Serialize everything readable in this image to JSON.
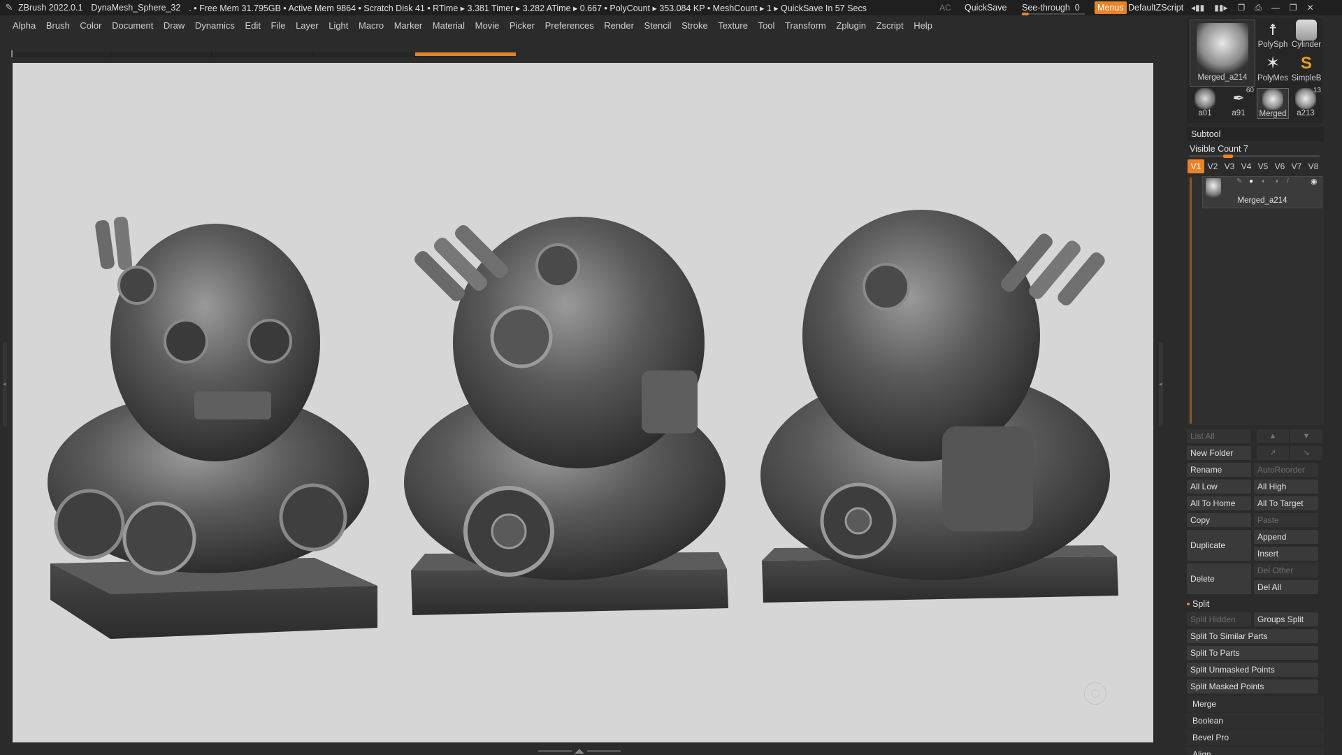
{
  "titlebar": {
    "app_version": "ZBrush 2022.0.1",
    "document": "DynaMesh_Sphere_32",
    "status": ". • Free Mem 31.795GB • Active Mem 9864 • Scratch Disk 41 • RTime ▸ 3.381 Timer ▸ 3.282 ATime ▸ 0.667 • PolyCount ▸ 353.084 KP • MeshCount ▸ 1 ▸ QuickSave In 57 Secs",
    "ac": "AC",
    "quicksave": "QuickSave",
    "see_through_label": "See-through",
    "see_through_value": "0",
    "menus": "Menus",
    "default_zscript": "DefaultZScript",
    "accent_color": "#e8832a"
  },
  "menubar": {
    "items": [
      "Alpha",
      "Brush",
      "Color",
      "Document",
      "Draw",
      "Dynamics",
      "Edit",
      "File",
      "Layer",
      "Light",
      "Macro",
      "Marker",
      "Material",
      "Movie",
      "Picker",
      "Preferences",
      "Render",
      "Stencil",
      "Stroke",
      "Texture",
      "Tool",
      "Transform",
      "Zplugin",
      "Zscript",
      "Help"
    ]
  },
  "tools": {
    "main": "Merged_a214",
    "items": [
      {
        "label": "PolySph",
        "icon": "polysphere-icon"
      },
      {
        "label": "Cylinder",
        "icon": "cylinder-icon"
      },
      {
        "label": "PolyMes",
        "icon": "polymesh-star-icon"
      },
      {
        "label": "SimpleB",
        "icon": "simplebrush-icon"
      },
      {
        "label": "a01",
        "badge": ""
      },
      {
        "label": "a91",
        "badge": "60"
      },
      {
        "label": "Merged",
        "badge": ""
      },
      {
        "label": "a213",
        "badge": "13"
      }
    ]
  },
  "subtool": {
    "title": "Subtool",
    "visible_count": "Visible Count 7",
    "vtabs": [
      "V1",
      "V2",
      "V3",
      "V4",
      "V5",
      "V6",
      "V7",
      "V8"
    ],
    "active_vtab": "V1",
    "item_name": "Merged_a214"
  },
  "buttons": {
    "list_all": "List All",
    "new_folder": "New Folder",
    "rename": "Rename",
    "auto_reorder": "AutoReorder",
    "all_low": "All Low",
    "all_high": "All High",
    "all_to_home": "All To Home",
    "all_to_target": "All To Target",
    "copy": "Copy",
    "paste": "Paste",
    "duplicate": "Duplicate",
    "append": "Append",
    "insert": "Insert",
    "delete": "Delete",
    "del_other": "Del Other",
    "del_all": "Del All"
  },
  "split": {
    "title": "Split",
    "split_hidden": "Split Hidden",
    "groups_split": "Groups Split",
    "split_similar": "Split To Similar Parts",
    "split_parts": "Split To Parts",
    "split_unmasked": "Split Unmasked Points",
    "split_masked": "Split Masked Points"
  },
  "subsections": [
    "Merge",
    "Boolean",
    "Bevel Pro",
    "Align"
  ]
}
